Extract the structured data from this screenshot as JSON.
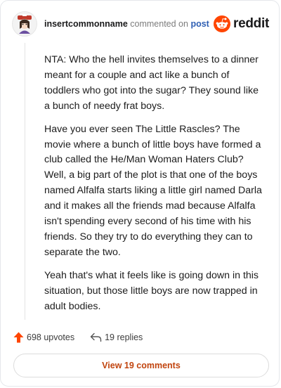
{
  "header": {
    "username": "insertcommonname",
    "commented_text": "commented on",
    "post_link": "post",
    "brand": "reddit"
  },
  "comment": {
    "paragraphs": [
      "NTA: Who the hell invites themselves to a dinner meant for a couple and act like a bunch of toddlers who got into the sugar? They sound like a bunch of needy frat boys.",
      "Have you ever seen The Little Rascles? The movie where a bunch of little boys have formed a club called the He/Man Woman Haters Club? Well, a big part of the plot is that one of the boys named Alfalfa starts liking a little girl named Darla and it makes all the friends mad because Alfalfa isn't spending every second of his time with his friends. So they try to do everything they can to separate the two.",
      "Yeah that's what it feels like is going down in this situation, but those little boys are now trapped in adult bodies."
    ]
  },
  "actions": {
    "upvotes": "698 upvotes",
    "replies": "19 replies"
  },
  "view_button": "View 19 comments",
  "colors": {
    "reddit_orange": "#ff4500",
    "upvote": "#ff4500",
    "link_blue": "#2f5fb3",
    "button_text": "#c1440e"
  },
  "icons": [
    "avatar",
    "reddit-logo-icon",
    "upvote-arrow-icon",
    "reply-arrow-icon"
  ]
}
